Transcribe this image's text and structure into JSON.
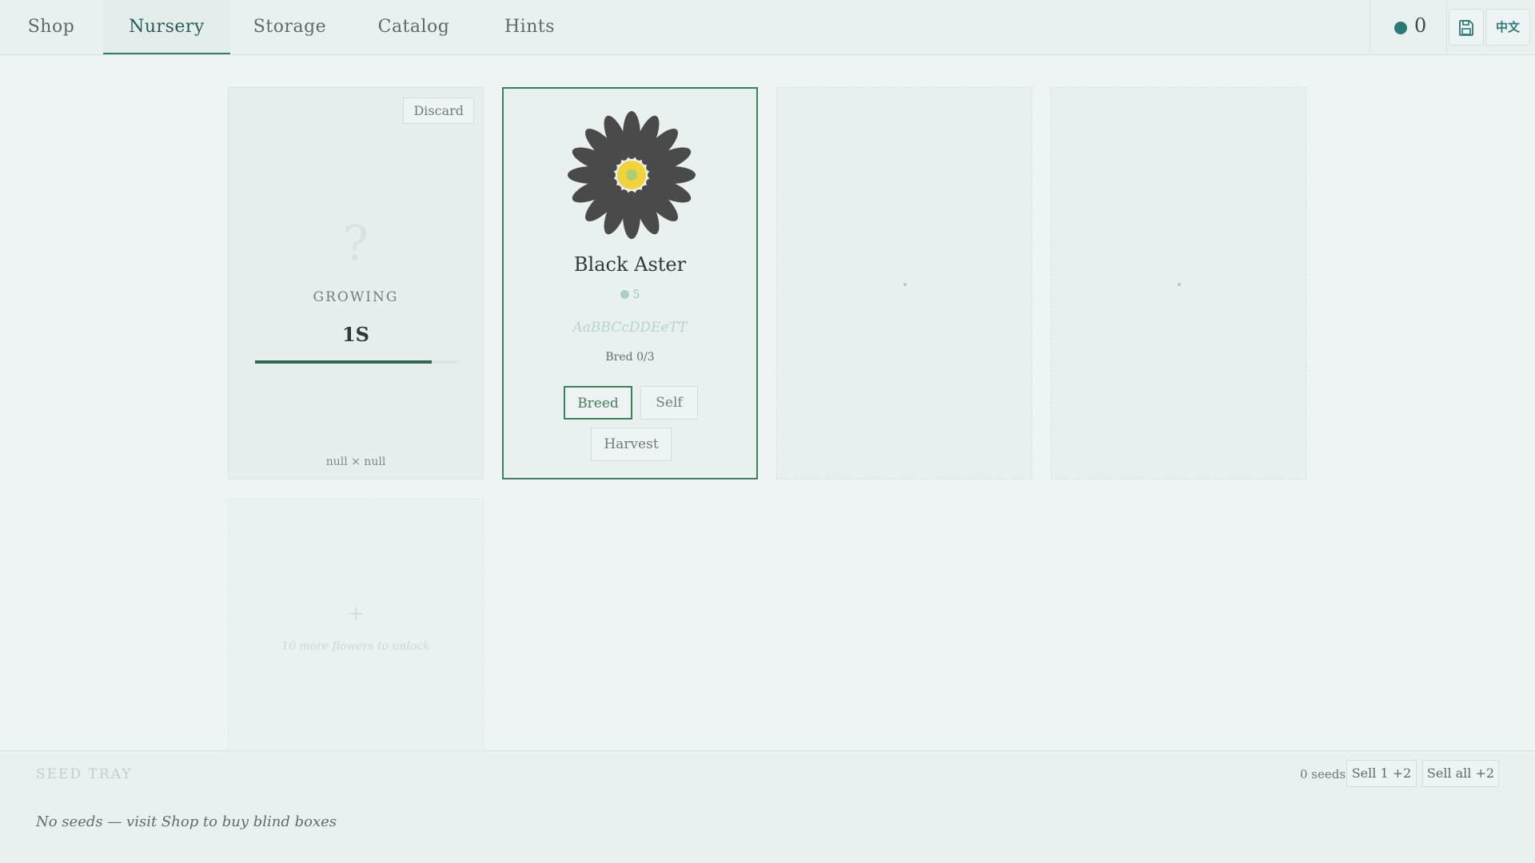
{
  "tabs": [
    {
      "label": "Shop"
    },
    {
      "label": "Nursery"
    },
    {
      "label": "Storage"
    },
    {
      "label": "Catalog"
    },
    {
      "label": "Hints"
    }
  ],
  "active_tab": "Nursery",
  "coins": "0",
  "lang_label": "中文",
  "colors": {
    "accent": "#2a7a76",
    "breed_green": "#3f7f5a",
    "flower_petal": "#4a4a4a",
    "flower_center": "#f2d33b"
  },
  "cards": {
    "growing": {
      "discard_label": "Discard",
      "placeholder": "?",
      "status": "GROWING",
      "timer": "1S",
      "progress_fraction": 0.87,
      "parents": "null × null"
    },
    "flower": {
      "name": "Black Aster",
      "icon": "aster-flower-icon",
      "stat_value": "5",
      "genes": "AaBBCcDDEeTT",
      "bred": "Bred 0/3",
      "breed_label": "Breed",
      "self_label": "Self",
      "harvest_label": "Harvest"
    },
    "locked": {
      "plus": "+",
      "text": "10 more flowers to unlock"
    }
  },
  "seed_tray": {
    "title": "SEED TRAY",
    "count": "0 seeds",
    "sell_one_label": "Sell 1 +2",
    "sell_all_label": "Sell all +2",
    "empty_message": "No seeds — visit Shop to buy blind boxes"
  }
}
